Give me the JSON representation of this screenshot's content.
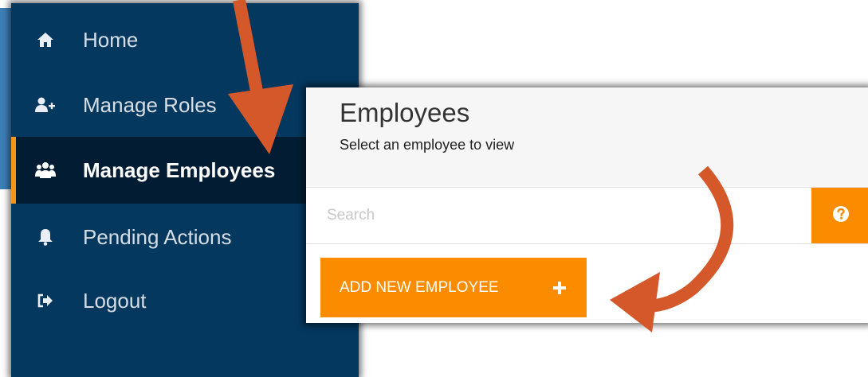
{
  "sidebar": {
    "items": [
      {
        "label": "Home",
        "icon": "home-icon"
      },
      {
        "label": "Manage Roles",
        "icon": "user-plus-icon"
      },
      {
        "label": "Manage Employees",
        "icon": "users-icon",
        "active": true
      },
      {
        "label": "Pending Actions",
        "icon": "bell-icon"
      },
      {
        "label": "Logout",
        "icon": "sign-out-icon"
      }
    ]
  },
  "panel": {
    "title": "Employees",
    "subtitle": "Select an employee to view",
    "search": {
      "placeholder": "Search",
      "value": ""
    },
    "help_icon": "question-circle-icon",
    "add_button_label": "ADD NEW EMPLOYEE",
    "add_button_icon": "plus-icon"
  },
  "colors": {
    "sidebar_bg": "#04385e",
    "sidebar_active_bg": "#021d33",
    "accent_orange": "#fb8c00",
    "arrow_color": "#d4582a",
    "backdrop_blue": "#3d7fb8"
  }
}
